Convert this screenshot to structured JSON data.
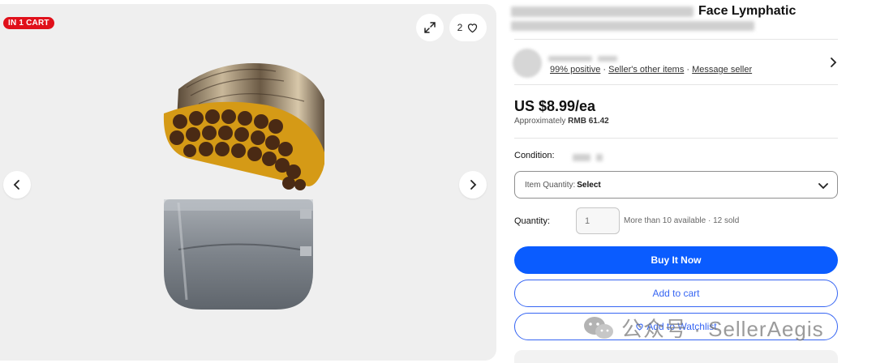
{
  "gallery": {
    "cart_badge": "IN 1 CART",
    "watch_count": "2",
    "icons": {
      "expand": "expand-icon",
      "heart": "heart-icon",
      "prev": "chevron-left-icon",
      "next": "chevron-right-icon"
    }
  },
  "listing": {
    "title_visible": "Face Lymphatic"
  },
  "seller": {
    "positive": "99% positive",
    "sep": " · ",
    "other_items": "Seller's other items",
    "message": "Message seller"
  },
  "price": {
    "main": "US $8.99/ea",
    "approx_prefix": "Approximately ",
    "approx_value": "RMB 61.42"
  },
  "condition": {
    "label": "Condition:"
  },
  "variation": {
    "label": "Item Quantity:",
    "value": "Select"
  },
  "quantity": {
    "label": "Quantity:",
    "placeholder": "1",
    "availability": "More than 10 available · 12 sold"
  },
  "actions": {
    "buy": "Buy It Now",
    "cart": "Add to cart",
    "watch": "Add to Watchlist"
  },
  "watermark": {
    "text": "公众号 · SellerAegis"
  },
  "colors": {
    "accent": "#3665f3",
    "buy": "#0a5cff",
    "badge": "#e0101a"
  }
}
